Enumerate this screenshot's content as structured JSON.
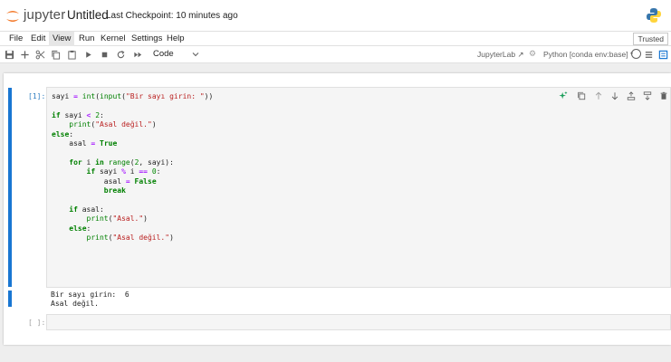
{
  "header": {
    "brand": "jupyter",
    "notebook_title": "Untitled",
    "checkpoint": "Last Checkpoint: 10 minutes ago"
  },
  "menu": {
    "items": [
      {
        "label": "File"
      },
      {
        "label": "Edit"
      },
      {
        "label": "View"
      },
      {
        "label": "Run"
      },
      {
        "label": "Kernel"
      },
      {
        "label": "Settings"
      },
      {
        "label": "Help"
      }
    ],
    "active_item": "View",
    "trusted": "Trusted"
  },
  "toolbar": {
    "icons": [
      "save-icon",
      "add-cell-icon",
      "cut-icon",
      "copy-icon",
      "paste-icon",
      "run-icon",
      "stop-icon",
      "restart-icon",
      "run-all-icon"
    ],
    "cell_type": "Code",
    "jupyterlab_link": "JupyterLab",
    "kernel_name": "Python [conda env:base] *"
  },
  "cells": {
    "code_cell": {
      "prompt": "[1]:",
      "source_lines": [
        "sayi = int(input(\"Bir sayı girin: \"))",
        "",
        "if sayi < 2:",
        "    print(\"Asal değil.\")",
        "else:",
        "    asal = True",
        "",
        "    for i in range(2, sayi):",
        "        if sayi % i == 0:",
        "            asal = False",
        "            break",
        "",
        "    if asal:",
        "        print(\"Asal.\")",
        "    else:",
        "        print(\"Asal değil.\")"
      ],
      "output_lines": [
        "Bir sayı girin:  6",
        "Asal değil."
      ]
    },
    "empty_cell": {
      "prompt": "[ ]:"
    }
  },
  "colors": {
    "accent": "#1976d2",
    "keyword": "#008000",
    "string": "#ba2121",
    "operator": "#aa22ff",
    "ai_icon": "#1b9e5a"
  }
}
